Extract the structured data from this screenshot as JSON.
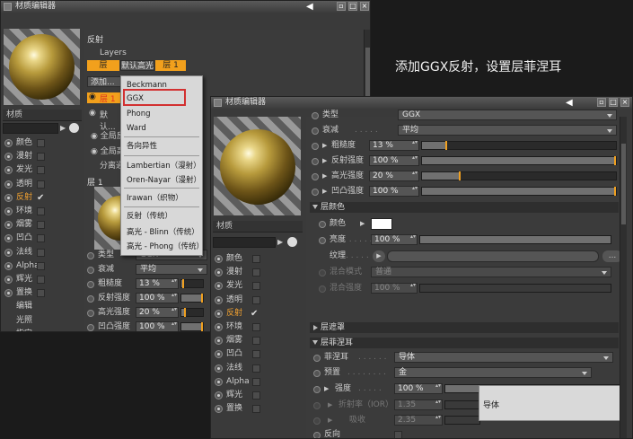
{
  "caption": "添加GGX反射，设置层菲涅耳",
  "back_window": {
    "title": "材质编辑器",
    "material_label": "材质",
    "channels": [
      {
        "label": "颜色",
        "checked": false,
        "active": false
      },
      {
        "label": "漫射",
        "checked": false,
        "active": false
      },
      {
        "label": "发光",
        "checked": false,
        "active": false
      },
      {
        "label": "透明",
        "checked": false,
        "active": false
      },
      {
        "label": "反射",
        "checked": true,
        "active": true
      },
      {
        "label": "环境",
        "checked": false,
        "active": false
      },
      {
        "label": "烟雾",
        "checked": false,
        "active": false
      },
      {
        "label": "凹凸",
        "checked": false,
        "active": false
      },
      {
        "label": "法线",
        "checked": false,
        "active": false
      },
      {
        "label": "Alpha",
        "checked": false,
        "active": false
      },
      {
        "label": "辉光",
        "checked": false,
        "active": false
      },
      {
        "label": "置换",
        "checked": false,
        "active": false
      }
    ],
    "extra_items": [
      "编辑",
      "光照",
      "指定"
    ],
    "panel_title": "反射",
    "layers_label": "Layers",
    "layer_tabs": [
      "层",
      "默认高光",
      "层 1"
    ],
    "add_button": "添加...",
    "layer_rows": [
      "层 1",
      "默认..."
    ],
    "global_rows": [
      "全局反...",
      "全局高...",
      "分离通..."
    ],
    "layer_header": "层 1",
    "props": [
      {
        "label": "类型",
        "value": "GGX"
      },
      {
        "label": "衰减",
        "value": "平均"
      },
      {
        "label": "粗糙度",
        "value": "13 %",
        "fill": 0.13
      },
      {
        "label": "反射强度",
        "value": "100 %",
        "fill": 1.0
      },
      {
        "label": "高光强度",
        "value": "20 %",
        "fill": 0.2
      },
      {
        "label": "凹凸强度",
        "value": "100 %",
        "fill": 1.0
      }
    ]
  },
  "dropdown_menu": {
    "items": [
      "Beckmann",
      "GGX",
      "Phong",
      "Ward",
      "各向异性",
      "Lambertian（漫射）",
      "Oren-Nayar（漫射）",
      "Irawan（织物）",
      "反射（传统）",
      "高光 - Blinn（传统）",
      "高光 - Phong（传统）"
    ],
    "highlighted": "GGX"
  },
  "front_window": {
    "title": "材质编辑器",
    "material_label": "材质",
    "channels": [
      {
        "label": "颜色",
        "checked": false,
        "active": false
      },
      {
        "label": "漫射",
        "checked": false,
        "active": false
      },
      {
        "label": "发光",
        "checked": false,
        "active": false
      },
      {
        "label": "透明",
        "checked": false,
        "active": false
      },
      {
        "label": "反射",
        "checked": true,
        "active": true
      },
      {
        "label": "环境",
        "checked": false,
        "active": false
      },
      {
        "label": "烟雾",
        "checked": false,
        "active": false
      },
      {
        "label": "凹凸",
        "checked": false,
        "active": false
      },
      {
        "label": "法线",
        "checked": false,
        "active": false
      },
      {
        "label": "Alpha",
        "checked": false,
        "active": false
      },
      {
        "label": "辉光",
        "checked": false,
        "active": false
      },
      {
        "label": "置换",
        "checked": false,
        "active": false
      }
    ],
    "type_row": {
      "label": "类型",
      "value": "GGX"
    },
    "attenuation": {
      "label": "衰减",
      "value": "平均"
    },
    "roughness": {
      "label": "粗糙度",
      "value": "13 %",
      "fill": 0.13
    },
    "reflect_strength": {
      "label": "反射强度",
      "value": "100 %",
      "fill": 1.0
    },
    "spec_strength": {
      "label": "高光强度",
      "value": "20 %",
      "fill": 0.2
    },
    "bump_strength": {
      "label": "凹凸强度",
      "value": "100 %",
      "fill": 1.0
    },
    "layer_color_section": "层颜色",
    "color_label": "颜色",
    "color_swatch": "#ffffff",
    "brightness": {
      "label": "亮度",
      "value": "100 %",
      "fill": 1.0
    },
    "texture_label": "纹理",
    "texture_more": "...",
    "blend_mode": {
      "label": "混合模式",
      "value": "普通"
    },
    "blend_strength": {
      "label": "混合强度",
      "value": "100 %"
    },
    "layer_mask_section": "层遮罩",
    "fresnel_section": "层菲涅耳",
    "fresnel": {
      "label": "菲涅耳",
      "value": "导体"
    },
    "preset": {
      "label": "预置",
      "value": "金"
    },
    "strength": {
      "label": "强度",
      "value": "100 %",
      "fill": 1.0
    },
    "ior": {
      "label": "折射率（IOR）",
      "value": "1.35"
    },
    "absorb": {
      "label": "吸收",
      "value": "2.35"
    },
    "popup_value": "导体",
    "last_row_label": "反向"
  },
  "colors": {
    "accent": "#f2a01c",
    "menu_highlight": "#d23030"
  }
}
